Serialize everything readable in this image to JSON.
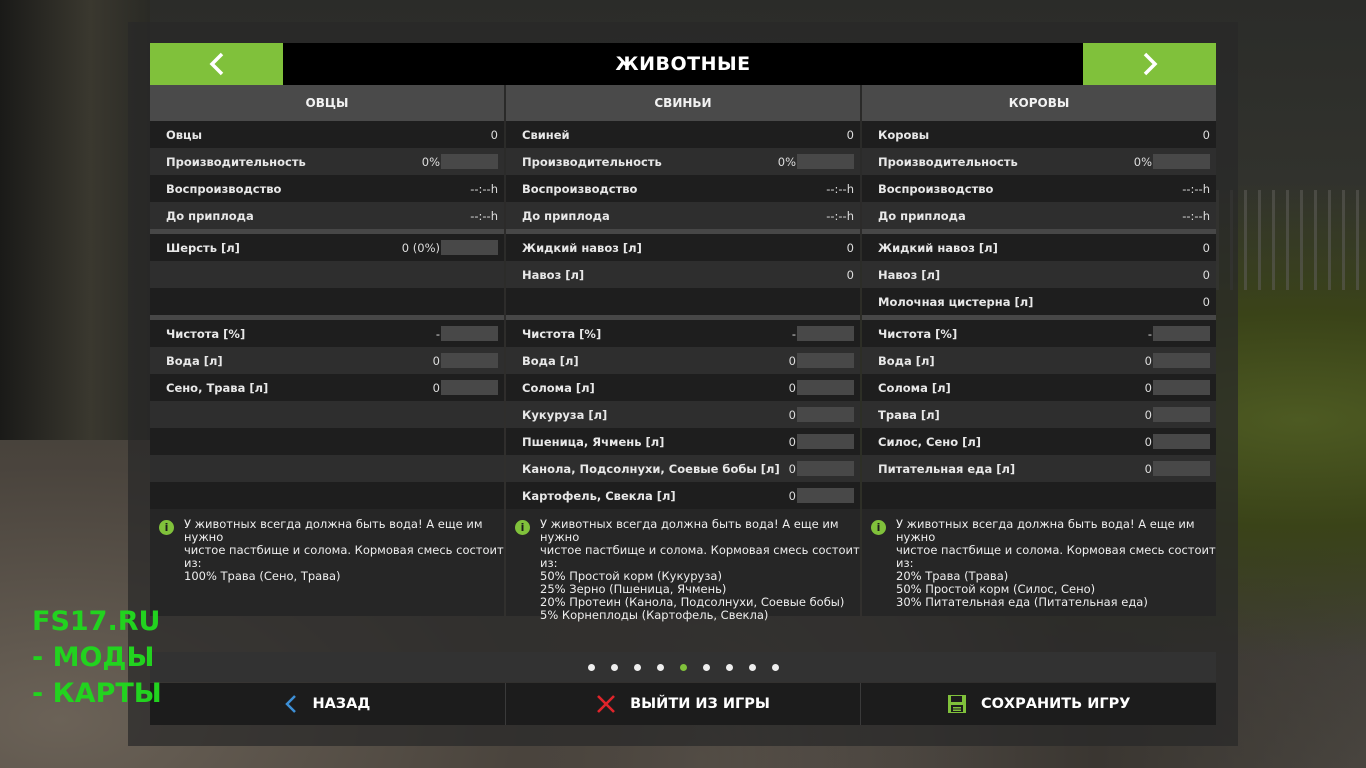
{
  "header": {
    "title": "ЖИВОТНЫЕ"
  },
  "columns": [
    {
      "title": "ОВЦЫ",
      "rows1": [
        {
          "label": "Овцы",
          "value": "0",
          "bar": false
        },
        {
          "label": "Производительность",
          "value": "0%",
          "bar": true
        },
        {
          "label": "Воспроизводство",
          "value": "--:--h",
          "bar": false
        },
        {
          "label": "До приплода",
          "value": "--:--h",
          "bar": false
        }
      ],
      "rows2": [
        {
          "label": "Шерсть [л]",
          "value": "0 (0%)",
          "bar": true
        },
        {
          "label": "",
          "value": "",
          "bar": false
        },
        {
          "label": "",
          "value": "",
          "bar": false
        }
      ],
      "rows3": [
        {
          "label": "Чистота [%]",
          "value": "-",
          "bar": true
        },
        {
          "label": "Вода [л]",
          "value": "0",
          "bar": true
        },
        {
          "label": "Сено, Трава [л]",
          "value": "0",
          "bar": true
        },
        {
          "label": "",
          "value": "",
          "bar": false
        },
        {
          "label": "",
          "value": "",
          "bar": false
        },
        {
          "label": "",
          "value": "",
          "bar": false
        },
        {
          "label": "",
          "value": "",
          "bar": false
        }
      ],
      "info": [
        "У животных всегда должна быть вода! А еще им нужно",
        "чистое пастбище и солома. Кормовая смесь состоит",
        "из:",
        "100% Трава (Сено, Трава)"
      ]
    },
    {
      "title": "СВИНЬИ",
      "rows1": [
        {
          "label": "Свиней",
          "value": "0",
          "bar": false
        },
        {
          "label": "Производительность",
          "value": "0%",
          "bar": true
        },
        {
          "label": "Воспроизводство",
          "value": "--:--h",
          "bar": false
        },
        {
          "label": "До приплода",
          "value": "--:--h",
          "bar": false
        }
      ],
      "rows2": [
        {
          "label": "Жидкий навоз [л]",
          "value": "0",
          "bar": false
        },
        {
          "label": "Навоз [л]",
          "value": "0",
          "bar": false
        },
        {
          "label": "",
          "value": "",
          "bar": false
        }
      ],
      "rows3": [
        {
          "label": "Чистота [%]",
          "value": "-",
          "bar": true
        },
        {
          "label": "Вода [л]",
          "value": "0",
          "bar": true
        },
        {
          "label": "Солома [л]",
          "value": "0",
          "bar": true
        },
        {
          "label": "Кукуруза [л]",
          "value": "0",
          "bar": true
        },
        {
          "label": "Пшеница, Ячмень [л]",
          "value": "0",
          "bar": true
        },
        {
          "label": "Канола, Подсолнухи, Соевые бобы [л]",
          "value": "0",
          "bar": true
        },
        {
          "label": "Картофель, Свекла [л]",
          "value": "0",
          "bar": true
        }
      ],
      "info": [
        "У животных всегда должна быть вода! А еще им нужно",
        "чистое пастбище и солома. Кормовая смесь состоит",
        "из:",
        "50% Простой корм (Кукуруза)",
        "25% Зерно (Пшеница, Ячмень)",
        "20% Протеин (Канола, Подсолнухи, Соевые бобы)",
        "5% Корнеплоды (Картофель, Свекла)"
      ]
    },
    {
      "title": "КОРОВЫ",
      "rows1": [
        {
          "label": "Коровы",
          "value": "0",
          "bar": false
        },
        {
          "label": "Производительность",
          "value": "0%",
          "bar": true
        },
        {
          "label": "Воспроизводство",
          "value": "--:--h",
          "bar": false
        },
        {
          "label": "До приплода",
          "value": "--:--h",
          "bar": false
        }
      ],
      "rows2": [
        {
          "label": "Жидкий навоз [л]",
          "value": "0",
          "bar": false
        },
        {
          "label": "Навоз [л]",
          "value": "0",
          "bar": false
        },
        {
          "label": "Молочная цистерна [л]",
          "value": "0",
          "bar": false
        }
      ],
      "rows3": [
        {
          "label": "Чистота [%]",
          "value": "-",
          "bar": true
        },
        {
          "label": "Вода [л]",
          "value": "0",
          "bar": true
        },
        {
          "label": "Солома [л]",
          "value": "0",
          "bar": true
        },
        {
          "label": "Трава [л]",
          "value": "0",
          "bar": true
        },
        {
          "label": "Силос, Сено [л]",
          "value": "0",
          "bar": true
        },
        {
          "label": "Питательная еда [л]",
          "value": "0",
          "bar": true
        },
        {
          "label": "",
          "value": "",
          "bar": false
        }
      ],
      "info": [
        "У животных всегда должна быть вода! А еще им нужно",
        "чистое пастбище и солома. Кормовая смесь состоит",
        "из:",
        "20% Трава (Трава)",
        "50% Простой корм (Силос, Сено)",
        "30% Питательная еда (Питательная еда)"
      ]
    }
  ],
  "pagination": {
    "total": 9,
    "active_index": 4
  },
  "footer": {
    "back": "НАЗАД",
    "quit": "ВЫЙТИ ИЗ ИГРЫ",
    "save": "СОХРАНИТЬ ИГРУ"
  },
  "watermark": [
    "FS17.RU",
    "- МОДЫ",
    "- КАРТЫ"
  ],
  "colors": {
    "accent": "#80c13b",
    "watermark": "#22d31f"
  }
}
